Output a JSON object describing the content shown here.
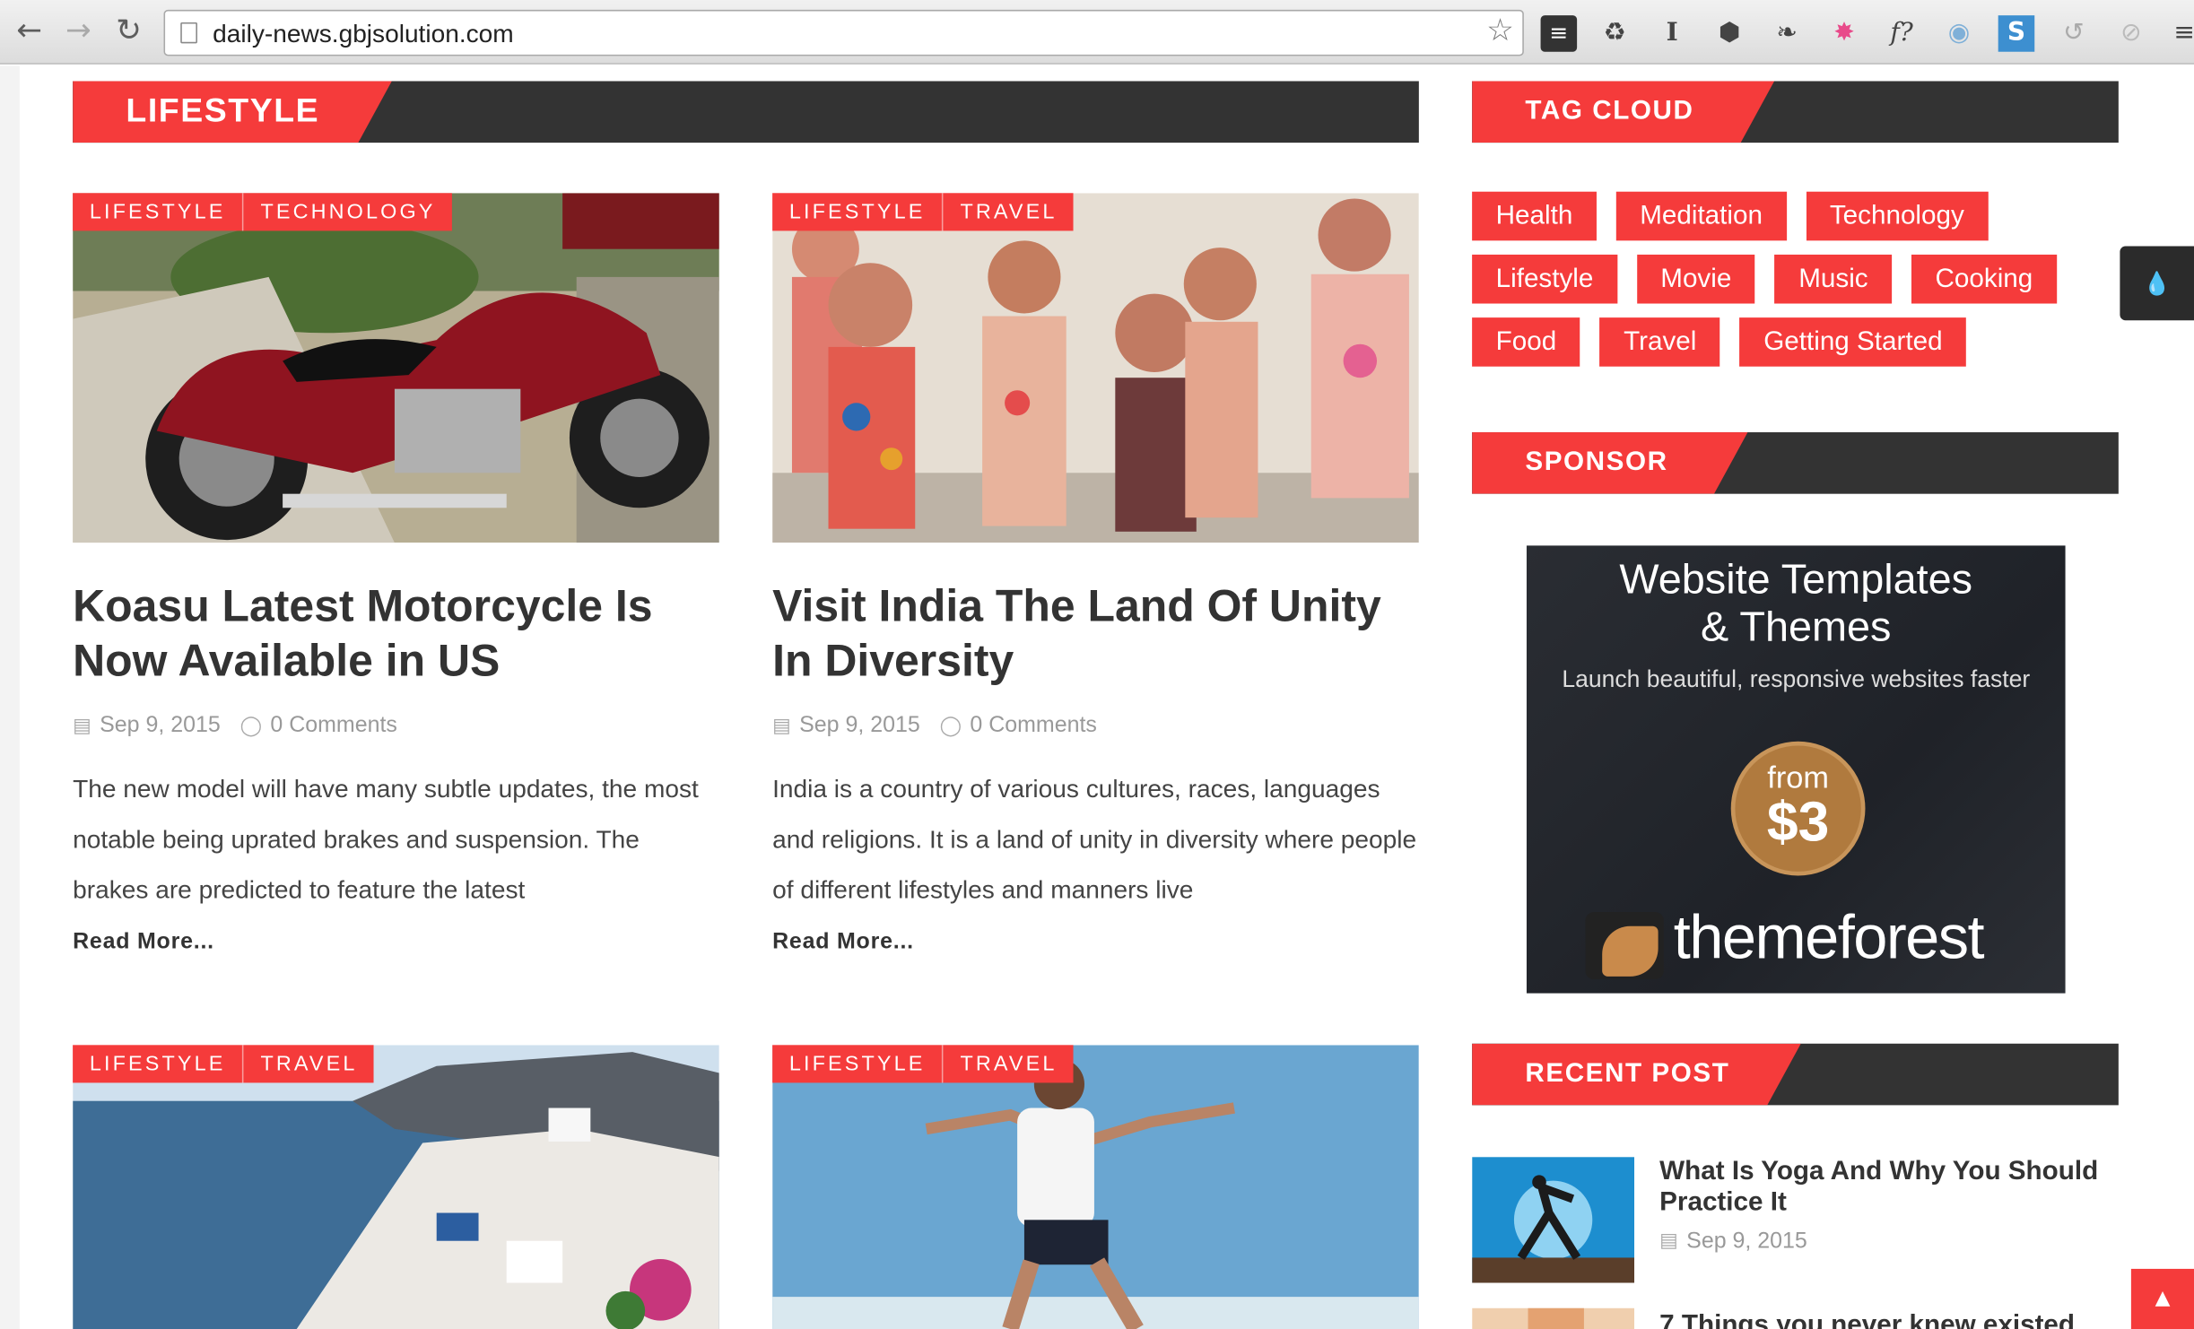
{
  "browser": {
    "url": "daily-news.gbjsolution.com",
    "back_icon": "←",
    "forward_icon": "→",
    "reload_icon": "↻",
    "star_icon": "☆",
    "extensions": [
      "≡",
      "♻",
      "I",
      "⬢",
      "❧",
      "✸",
      "f?",
      "◉",
      "S",
      "↺",
      "⊘",
      "≡"
    ]
  },
  "lifestyle_section": {
    "heading": "LIFESTYLE"
  },
  "posts": [
    {
      "tags": [
        "LIFESTYLE",
        "TECHNOLOGY"
      ],
      "title": "Koasu Latest Motorcycle Is Now Available in US",
      "date": "Sep 9, 2015",
      "comments": "0 Comments",
      "excerpt": "The new model will have many subtle updates, the most notable being uprated brakes and suspension. The brakes are predicted to feature the latest",
      "read_more": "Read More..."
    },
    {
      "tags": [
        "LIFESTYLE",
        "TRAVEL"
      ],
      "title": "Visit India The Land Of Unity In Diversity",
      "date": "Sep 9, 2015",
      "comments": "0 Comments",
      "excerpt": "India is a country of various cultures, races, languages and religions. It is a land of unity in diversity where people of different lifestyles and manners live",
      "read_more": "Read More..."
    },
    {
      "tags": [
        "LIFESTYLE",
        "TRAVEL"
      ]
    },
    {
      "tags": [
        "LIFESTYLE",
        "TRAVEL"
      ]
    }
  ],
  "sidebar": {
    "tag_cloud_heading": "TAG CLOUD",
    "tag_rows": [
      [
        "Health",
        "Meditation",
        "Technology"
      ],
      [
        "Lifestyle",
        "Movie",
        "Music",
        "Cooking"
      ],
      [
        "Food",
        "Travel",
        "Getting Started"
      ]
    ],
    "sponsor_heading": "SPONSOR",
    "ad": {
      "title_line1": "Website Templates",
      "title_line2": "& Themes",
      "subtitle": "Launch beautiful, responsive websites faster",
      "from": "from",
      "price": "$3",
      "brand": "themeforest"
    },
    "recent_heading": "RECENT POST",
    "recent_posts": [
      {
        "title": "What Is Yoga And Why You Should Practice It",
        "date": "Sep 9, 2015"
      },
      {
        "title": "7 Things you never knew existed"
      }
    ]
  },
  "widgets": {
    "drop_icon": "💧",
    "back_to_top_icon": "▲"
  },
  "colors": {
    "accent": "#f53b3b",
    "dark_bar": "#333333"
  }
}
